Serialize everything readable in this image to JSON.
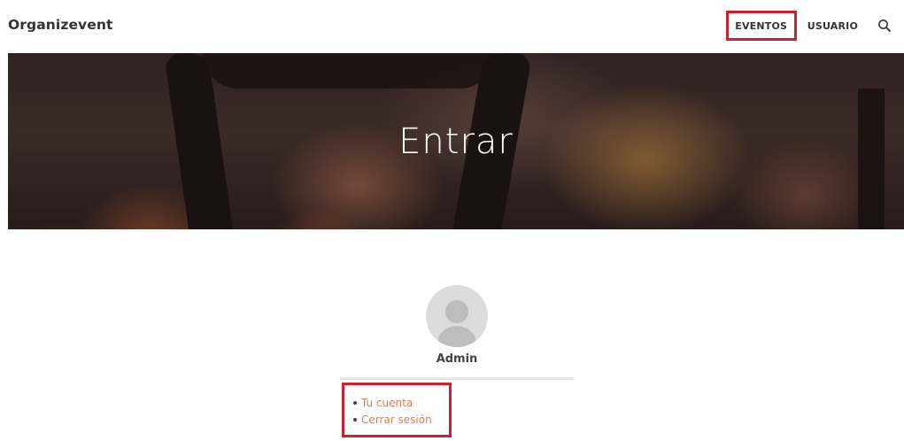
{
  "header": {
    "brand": "Organizevent",
    "nav": [
      {
        "label": "EVENTOS",
        "highlighted": true
      },
      {
        "label": "USUARIO",
        "highlighted": false
      }
    ],
    "search_icon": "search-icon"
  },
  "hero": {
    "title": "Entrar"
  },
  "profile": {
    "avatar_icon": "user-avatar-placeholder",
    "name": "Admin"
  },
  "account_links": [
    {
      "label": "Tu cuenta"
    },
    {
      "label": "Cerrar sesión"
    }
  ],
  "colors": {
    "highlight_border": "#d0212b",
    "link": "#e07a55",
    "avatar_bg": "#dcdcdc"
  }
}
